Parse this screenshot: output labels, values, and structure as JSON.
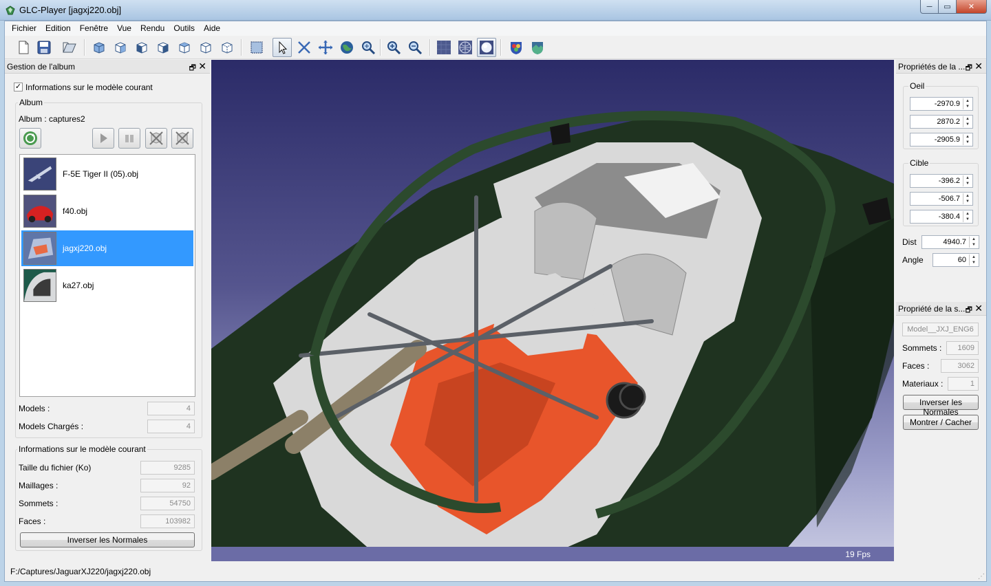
{
  "window": {
    "title": "GLC-Player [jagxj220.obj]",
    "minimize_glyph": "─",
    "maximize_glyph": "▭",
    "close_glyph": "✕"
  },
  "menubar": {
    "items": [
      "Fichier",
      "Edition",
      "Fenêtre",
      "Vue",
      "Rendu",
      "Outils",
      "Aide"
    ]
  },
  "toolbar": {
    "icons": [
      "new-file-icon",
      "save-icon",
      "open-icon",
      "view-front-icon",
      "view-back-icon",
      "view-left-icon",
      "view-right-icon",
      "view-top-icon",
      "view-bottom-icon",
      "view-iso-icon",
      "fit-all-icon",
      "select-cursor-icon",
      "reframe-icon",
      "pan-icon",
      "orbit-icon",
      "zoom-window-icon",
      "zoom-in-icon",
      "zoom-out-icon",
      "render-wireframe-icon",
      "render-mesh-icon",
      "render-shaded-icon",
      "material-icon",
      "background-icon"
    ]
  },
  "album_panel": {
    "title": "Gestion de l'album",
    "float_glyph": "🗗",
    "close_glyph": "✕",
    "info_checkbox_label": "Informations sur le modèle courant",
    "info_checked": true,
    "album_group_title": "Album",
    "album_name": "Album : captures2",
    "items": [
      {
        "name": "F-5E Tiger II (05).obj",
        "selected": false
      },
      {
        "name": "f40.obj",
        "selected": false
      },
      {
        "name": "jagxj220.obj",
        "selected": true
      },
      {
        "name": "ka27.obj",
        "selected": false
      }
    ],
    "models_label": "Models :",
    "models_value": "4",
    "loaded_label": "Models Chargés :",
    "loaded_value": "4",
    "model_info_title": "Informations sur le modèle courant",
    "file_size_label": "Taille du fichier (Ko)",
    "file_size_value": "9285",
    "meshes_label": "Maillages :",
    "meshes_value": "92",
    "vertices_label": "Sommets :",
    "vertices_value": "54750",
    "faces_label": "Faces :",
    "faces_value": "103982",
    "invert_normals_label": "Inverser les Normales"
  },
  "camera_panel": {
    "title": "Propriétés de la ...",
    "float_glyph": "🗗",
    "close_glyph": "✕",
    "eye_title": "Oeil",
    "eye": [
      "-2970.9",
      "2870.2",
      "-2905.9"
    ],
    "target_title": "Cible",
    "target": [
      "-396.2",
      "-506.7",
      "-380.4"
    ],
    "dist_label": "Dist",
    "dist_value": "4940.7",
    "angle_label": "Angle",
    "angle_value": "60"
  },
  "selection_panel": {
    "title": "Propriété de la s...",
    "float_glyph": "🗗",
    "close_glyph": "✕",
    "name_value": "Model__JXJ_ENG6",
    "vertices_label": "Sommets :",
    "vertices_value": "1609",
    "faces_label": "Faces :",
    "faces_value": "3062",
    "materials_label": "Materiaux :",
    "materials_value": "1",
    "invert_normals_label": "Inverser les Normales",
    "show_hide_label": "Montrer / Cacher"
  },
  "viewport": {
    "fps": "19 Fps",
    "colors": {
      "body": "#1f3320",
      "engine": "#e8552b",
      "interior": "#d9d9d9",
      "tube": "#5b6067"
    }
  },
  "statusbar": {
    "path": "F:/Captures/JaguarXJ220/jagxj220.obj"
  }
}
